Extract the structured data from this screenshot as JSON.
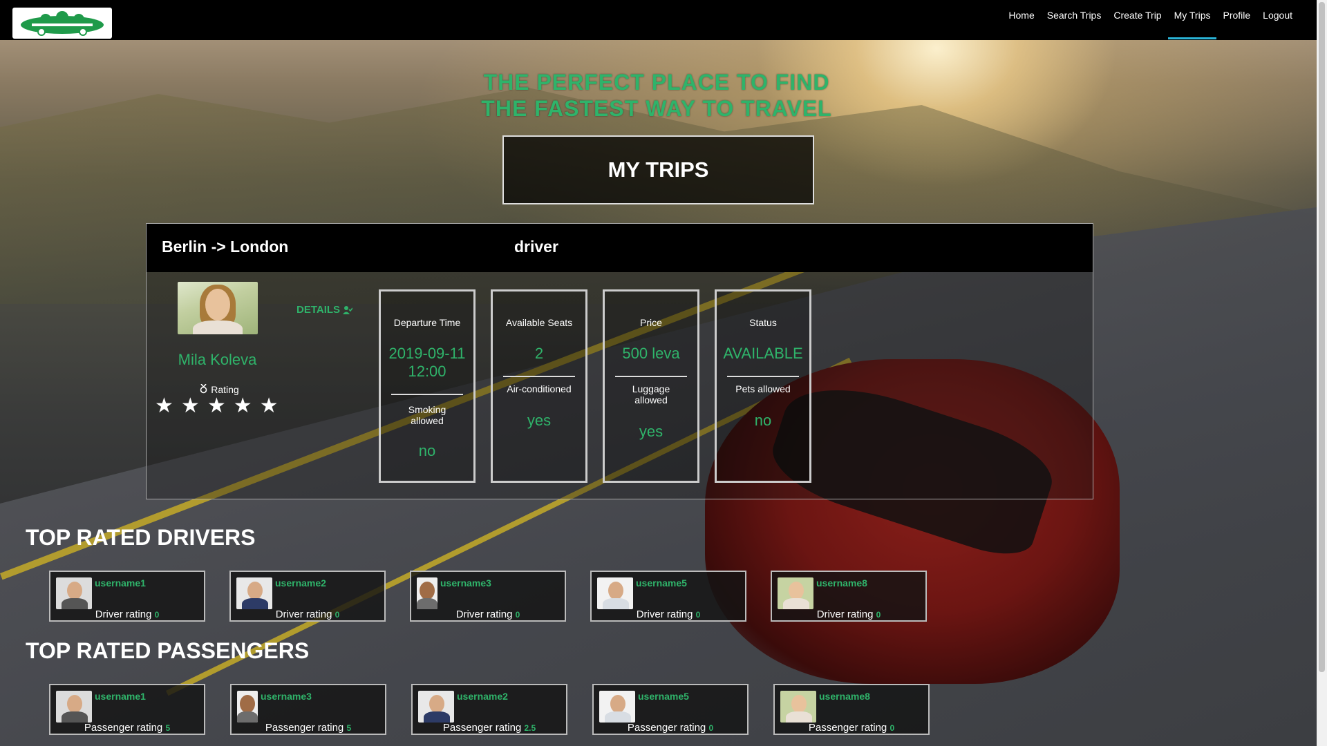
{
  "colors": {
    "accent": "#2fb36a",
    "nav_active": "#2ab3d6",
    "nav_bg": "#000000"
  },
  "nav": {
    "logo_icon": "car-logo-icon",
    "links": [
      "Home",
      "Search Trips",
      "Create Trip",
      "My Trips",
      "Profile",
      "Logout"
    ],
    "active": "My Trips"
  },
  "hero": {
    "tagline_line1": "THE PERFECT PLACE TO FIND",
    "tagline_line2": "THE FASTEST WAY TO TRAVEL",
    "page_title": "MY TRIPS"
  },
  "trip": {
    "route": "Berlin -> London",
    "role": "driver",
    "details_label": "DETAILS",
    "driver_name": "Mila Koleva",
    "rating_label": "Rating",
    "stars": 5,
    "star_glyph": "★",
    "boxes": [
      {
        "label": "Departure Time",
        "value": "2019-09-11 12:00",
        "sub_label": "Smoking allowed",
        "sub_value": "no"
      },
      {
        "label": "Available Seats",
        "value": "2",
        "sub_label": "Air-conditioned",
        "sub_value": "yes"
      },
      {
        "label": "Price",
        "value": "500 leva",
        "sub_label": "Luggage allowed",
        "sub_value": "yes"
      },
      {
        "label": "Status",
        "value": "AVAILABLE",
        "sub_label": "Pets allowed",
        "sub_value": "no"
      }
    ]
  },
  "top_drivers": {
    "title": "TOP RATED DRIVERS",
    "rating_label": "Driver rating",
    "items": [
      {
        "username": "username1",
        "rating": "0"
      },
      {
        "username": "username2",
        "rating": "0"
      },
      {
        "username": "username3",
        "rating": "0"
      },
      {
        "username": "username5",
        "rating": "0"
      },
      {
        "username": "username8",
        "rating": "0"
      }
    ]
  },
  "top_passengers": {
    "title": "TOP RATED PASSENGERS",
    "rating_label": "Passenger rating",
    "items": [
      {
        "username": "username1",
        "rating": "5"
      },
      {
        "username": "username3",
        "rating": "5"
      },
      {
        "username": "username2",
        "rating": "2.5"
      },
      {
        "username": "username5",
        "rating": "0"
      },
      {
        "username": "username8",
        "rating": "0"
      }
    ]
  }
}
